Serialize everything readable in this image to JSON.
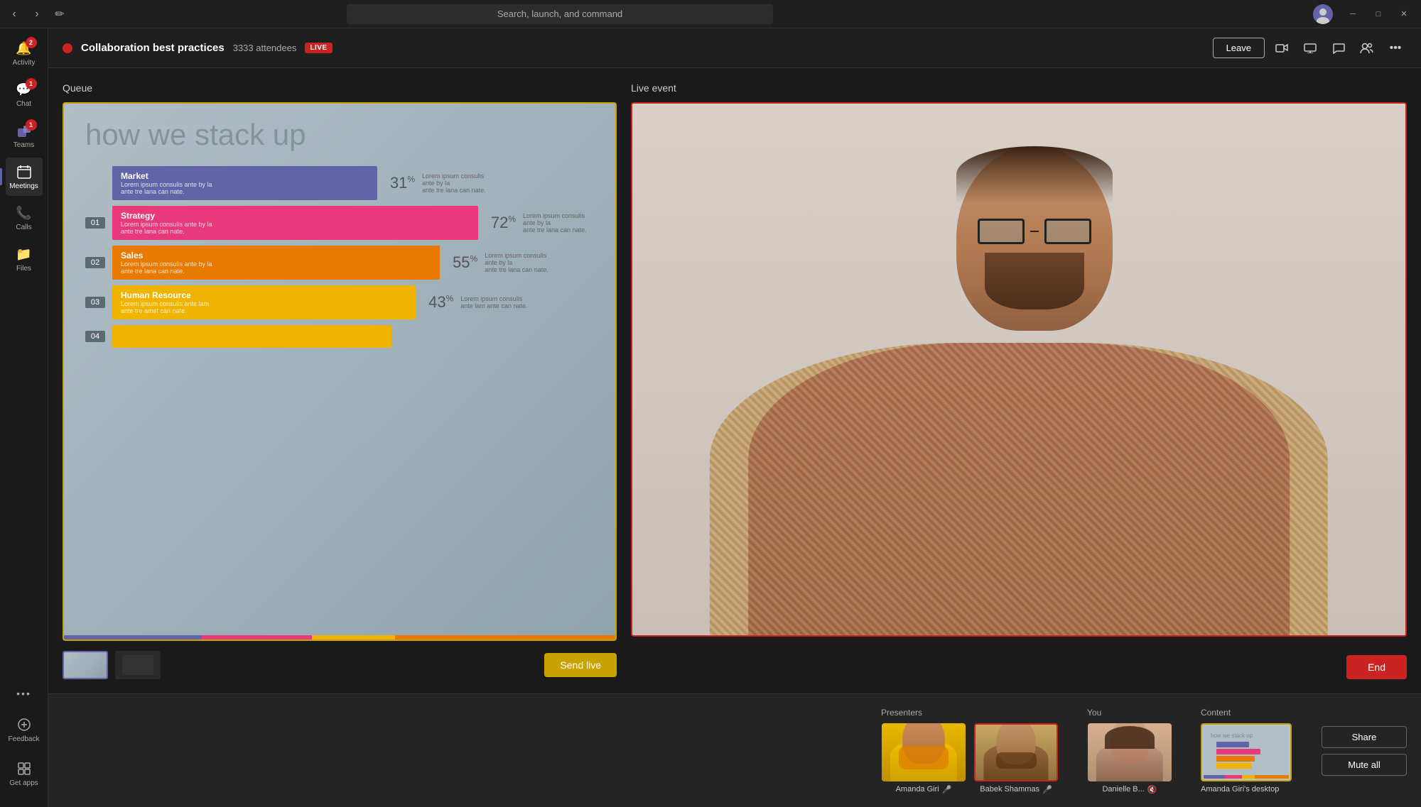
{
  "titleBar": {
    "searchPlaceholder": "Search, launch, and command",
    "windowControls": {
      "minimize": "─",
      "maximize": "□",
      "close": "✕"
    }
  },
  "sidebar": {
    "items": [
      {
        "id": "activity",
        "label": "Activity",
        "icon": "🔔",
        "badge": "2"
      },
      {
        "id": "chat",
        "label": "Chat",
        "icon": "💬",
        "badge": "1"
      },
      {
        "id": "teams",
        "label": "Teams",
        "icon": "👥",
        "badge": "1"
      },
      {
        "id": "meetings",
        "label": "Meetings",
        "icon": "📅",
        "badge": null
      },
      {
        "id": "calls",
        "label": "Calls",
        "icon": "📞",
        "badge": null
      },
      {
        "id": "files",
        "label": "Files",
        "icon": "📁",
        "badge": null
      },
      {
        "id": "more",
        "label": "...",
        "icon": "•••",
        "badge": null
      }
    ],
    "bottom": [
      {
        "id": "feedback",
        "label": "Feedback",
        "icon": "⚙"
      },
      {
        "id": "getapps",
        "label": "Get apps",
        "icon": "🧩"
      }
    ]
  },
  "header": {
    "liveIndicator": true,
    "title": "Collaboration best practices",
    "attendees": "3333 attendees",
    "liveBadge": "LIVE",
    "leaveBtn": "Leave",
    "icons": [
      "camera",
      "screen-share",
      "chat",
      "participants",
      "more"
    ]
  },
  "queue": {
    "label": "Queue",
    "slide": {
      "title": "how we stack up",
      "bars": [
        {
          "number": null,
          "label": "Market",
          "sublabel": "Lorem ipsum consulis ante by la\nante tre lana can nate.",
          "percent": "31",
          "color": "#6264a7",
          "width": "55"
        },
        {
          "number": "01",
          "label": "Strategy",
          "sublabel": "Lorem ipsum consulis ante by la\nante tre lana can nate.",
          "percent": "72",
          "color": "#e83a7a",
          "width": "78"
        },
        {
          "number": "02",
          "label": "Sales",
          "sublabel": "Lorem ipsum consulis ante by la\nante tre lana can nate.",
          "percent": "55",
          "color": "#e87a00",
          "width": "68"
        },
        {
          "number": "03",
          "label": "Human Resource",
          "sublabel": "Lorem ipsum consulis ante lam\nante tre amet can nate.",
          "percent": "43",
          "color": "#f0b400",
          "width": "63"
        },
        {
          "number": "04",
          "label": "",
          "sublabel": "",
          "percent": "",
          "color": "#f0b400",
          "width": "58"
        }
      ],
      "progressSegments": [
        {
          "color": "#6264a7",
          "width": "25"
        },
        {
          "color": "#e83a7a",
          "width": "20"
        },
        {
          "color": "#f0b400",
          "width": "15"
        },
        {
          "color": "#e87a00",
          "width": "40"
        }
      ]
    },
    "thumbnails": [
      {
        "active": true,
        "type": "slide"
      },
      {
        "active": false,
        "type": "slide-speaker"
      }
    ],
    "sendLiveBtn": "Send live"
  },
  "liveEvent": {
    "label": "Live event",
    "endBtn": "End"
  },
  "participants": {
    "presentersLabel": "Presenters",
    "youLabel": "You",
    "contentLabel": "Content",
    "presenters": [
      {
        "name": "Amanda Giri",
        "muted": false,
        "active": false
      },
      {
        "name": "Babek Shammas",
        "muted": false,
        "active": true
      }
    ],
    "you": [
      {
        "name": "Danielle B...",
        "muted": true,
        "active": false
      }
    ],
    "content": [
      {
        "name": "Amanda Giri's desktop"
      }
    ],
    "actions": {
      "shareBtn": "Share",
      "muteAllBtn": "Mute all"
    }
  }
}
